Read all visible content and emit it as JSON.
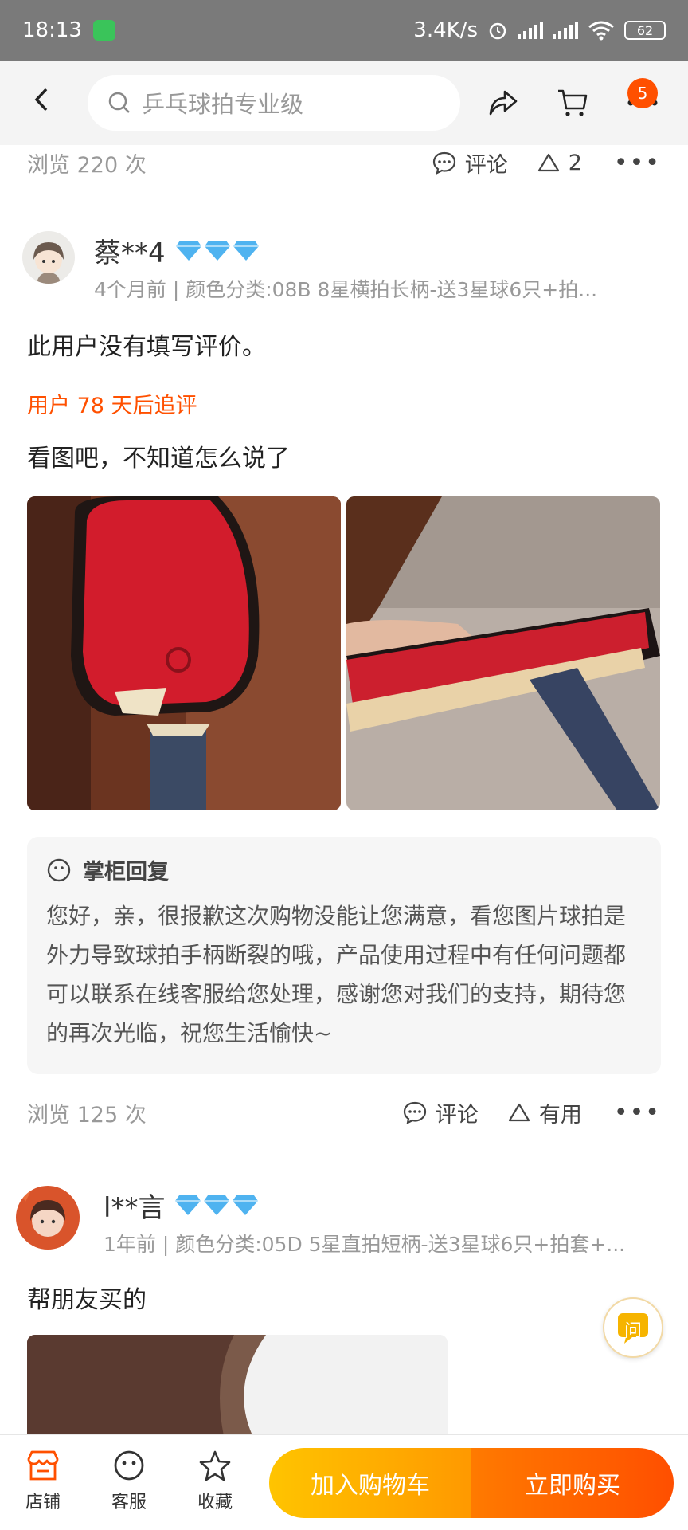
{
  "status_bar": {
    "time": "18:13",
    "speed": "3.4K/s",
    "battery": "62"
  },
  "nav": {
    "search_placeholder": "乒乓球拍专业级",
    "cart_badge": "5"
  },
  "prev_review": {
    "views": "浏览 220 次",
    "comment_label": "评论",
    "useful_count": "2"
  },
  "review1": {
    "username": "蔡**4",
    "sub": "4个月前 | 颜色分类:08B 8星横拍长柄-送3星球6只+拍...",
    "text": "此用户没有填写评价。",
    "followup_label": "用户 78 天后追评",
    "followup_text": "看图吧，不知道怎么说了",
    "reply_title": "掌柜回复",
    "reply_text": "您好，亲，很报歉这次购物没能让您满意，看您图片球拍是外力导致球拍手柄断裂的哦，产品使用过程中有任何问题都可以联系在线客服给您处理，感谢您对我们的支持，期待您的再次光临，祝您生活愉快~",
    "views": "浏览 125 次",
    "comment_label": "评论",
    "useful_label": "有用"
  },
  "review2": {
    "username": "l**言",
    "sub": "1年前 | 颜色分类:05D 5星直拍短柄-送3星球6只+拍套+...",
    "text": "帮朋友买的"
  },
  "float_ask": "问",
  "bottom": {
    "shop": "店铺",
    "service": "客服",
    "favorite": "收藏",
    "add_cart": "加入购物车",
    "buy_now": "立即购买"
  }
}
